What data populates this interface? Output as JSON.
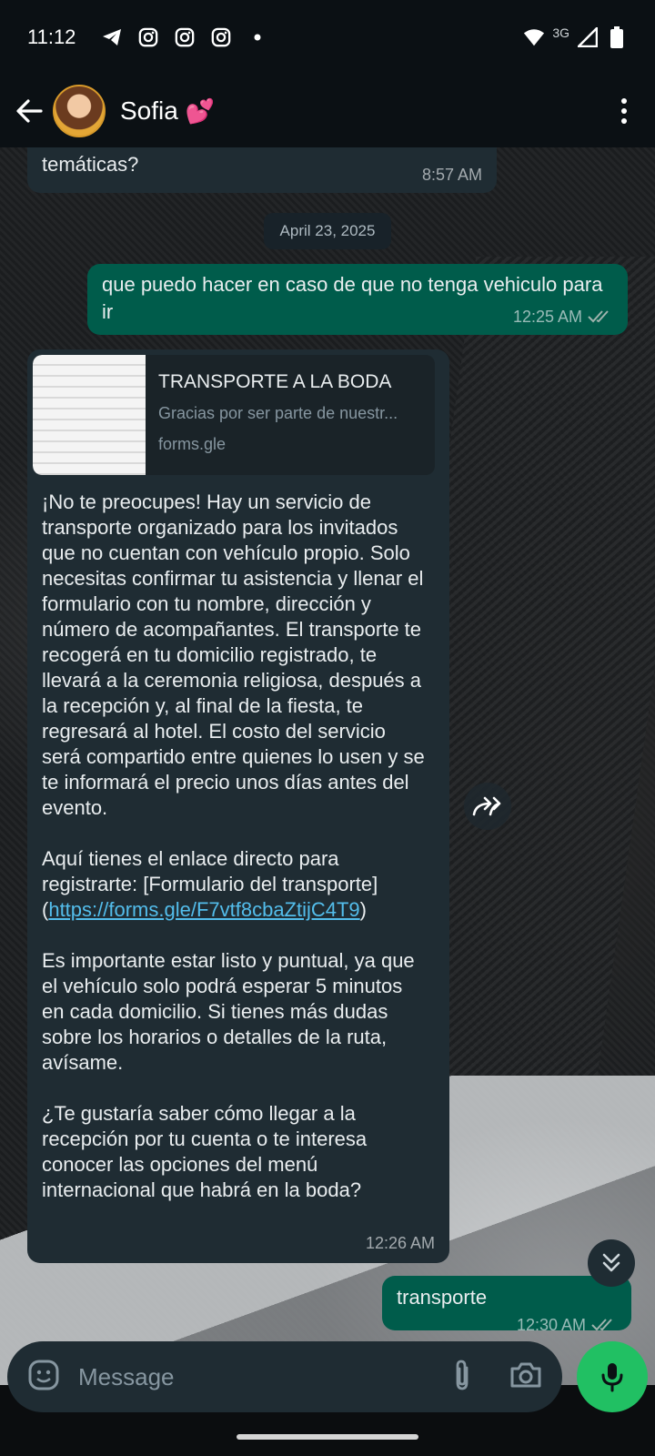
{
  "status_bar": {
    "time": "11:12",
    "network": "3G",
    "icons": [
      "telegram-icon",
      "instagram-icon",
      "instagram-icon",
      "instagram-icon",
      "dot-icon",
      "wifi-icon",
      "signal-icon",
      "battery-icon"
    ]
  },
  "header": {
    "contact_name": "Sofia",
    "emoji": "💕"
  },
  "messages": {
    "prev_incoming": {
      "text": "internacional o detalles sobre las actividades\ntemáticas?",
      "time": "8:57 AM"
    },
    "date_separator": "April 23, 2025",
    "outgoing_1": {
      "text": "que puedo hacer en caso de que no tenga vehiculo para ir",
      "time": "12:25 AM"
    },
    "incoming_main": {
      "link_preview": {
        "title": "TRANSPORTE A LA BODA",
        "description": "Gracias por ser parte de nuestr...",
        "domain": "forms.gle"
      },
      "paragraph_1": "¡No te preocupes! Hay un servicio de transporte organizado para los invitados que no cuentan con vehículo propio. Solo necesitas confirmar tu asistencia y llenar el formulario con tu nombre, dirección y número de acompañantes. El transporte te recogerá en tu domicilio registrado, te llevará a la ceremonia religiosa, después a la recepción y, al final de la fiesta, te regresará al hotel. El costo del servicio será compartido entre quienes lo usen y se te informará el precio unos días antes del evento.",
      "paragraph_2_prefix": "Aquí tienes el enlace directo para registrarte: [Formulario del transporte](",
      "link_url": "https://forms.gle/F7vtf8cbaZtijC4T9",
      "paragraph_2_suffix": ")",
      "paragraph_3": "Es importante estar listo y puntual, ya que el vehículo solo podrá esperar 5 minutos en cada domicilio. Si tienes más dudas sobre los horarios o detalles de la ruta, avísame.",
      "paragraph_4": "¿Te gustaría saber cómo llegar a la recepción por tu cuenta o te interesa conocer las opciones del menú internacional que habrá en la boda?",
      "time": "12:26 AM"
    },
    "outgoing_2": {
      "text": "transporte",
      "time": "12:30 AM"
    }
  },
  "input": {
    "placeholder": "Message"
  },
  "colors": {
    "incoming_bubble": "#1f2c33",
    "outgoing_bubble": "#005c4b",
    "link": "#53bdeb",
    "mic_button": "#21c063"
  }
}
